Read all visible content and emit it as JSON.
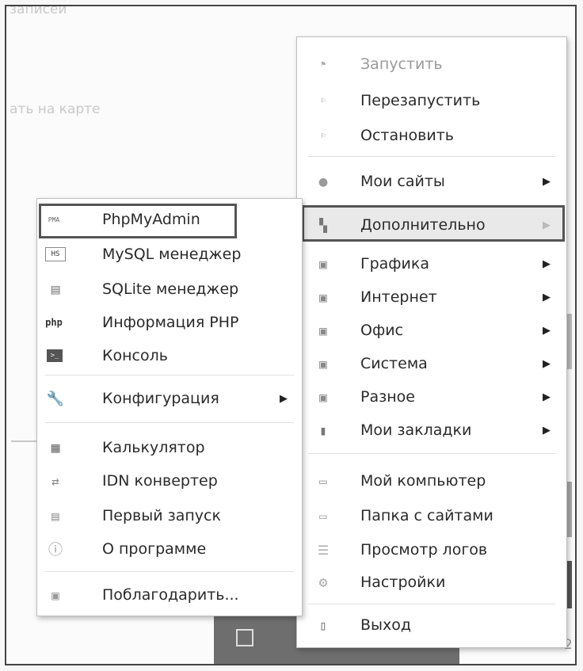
{
  "background": {
    "top_text": "записей",
    "map_text": "ать на карте",
    "bottom_right_text": "2"
  },
  "main_menu": {
    "items": [
      {
        "label": "Запустить",
        "icon": "flag-icon",
        "disabled": true
      },
      {
        "label": "Перезапустить",
        "icon": "flag-restart-icon"
      },
      {
        "label": "Остановить",
        "icon": "flag-stop-icon"
      },
      {
        "label": "Мои сайты",
        "icon": "globe-icon",
        "submenu": true
      },
      {
        "label": "Дополнительно",
        "icon": "blocks-icon",
        "submenu": true,
        "highlighted": true
      },
      {
        "label": "Графика",
        "icon": "folder-icon",
        "submenu": true
      },
      {
        "label": "Интернет",
        "icon": "folder-icon",
        "submenu": true
      },
      {
        "label": "Офис",
        "icon": "folder-icon",
        "submenu": true
      },
      {
        "label": "Система",
        "icon": "folder-icon",
        "submenu": true
      },
      {
        "label": "Разное",
        "icon": "folder-icon",
        "submenu": true
      },
      {
        "label": "Мои закладки",
        "icon": "book-icon",
        "submenu": true
      },
      {
        "label": "Мой компьютер",
        "icon": "computer-icon"
      },
      {
        "label": "Папка с сайтами",
        "icon": "folder-open-icon"
      },
      {
        "label": "Просмотр логов",
        "icon": "log-icon"
      },
      {
        "label": "Настройки",
        "icon": "gear-icon"
      },
      {
        "label": "Выход",
        "icon": "exit-icon"
      }
    ],
    "arrow": "▶"
  },
  "sub_menu": {
    "items": [
      {
        "label": "PhpMyAdmin",
        "icon": "phpmyadmin-icon",
        "icon_text": "PMA",
        "highlighted": true
      },
      {
        "label": "MySQL менеджер",
        "icon": "heidisql-icon",
        "icon_text": "HS"
      },
      {
        "label": "SQLite менеджер",
        "icon": "sqlite-icon"
      },
      {
        "label": "Информация PHP",
        "icon": "php-icon",
        "icon_text": "php"
      },
      {
        "label": "Консоль",
        "icon": "console-icon"
      },
      {
        "label": "Конфигурация",
        "icon": "wrench-icon",
        "submenu": true
      },
      {
        "label": "Калькулятор",
        "icon": "calculator-icon"
      },
      {
        "label": "IDN конвертер",
        "icon": "idn-icon"
      },
      {
        "label": "Первый запуск",
        "icon": "first-run-icon"
      },
      {
        "label": "О программе",
        "icon": "info-icon"
      },
      {
        "label": "Поблагодарить...",
        "icon": "thanks-icon"
      }
    ]
  }
}
